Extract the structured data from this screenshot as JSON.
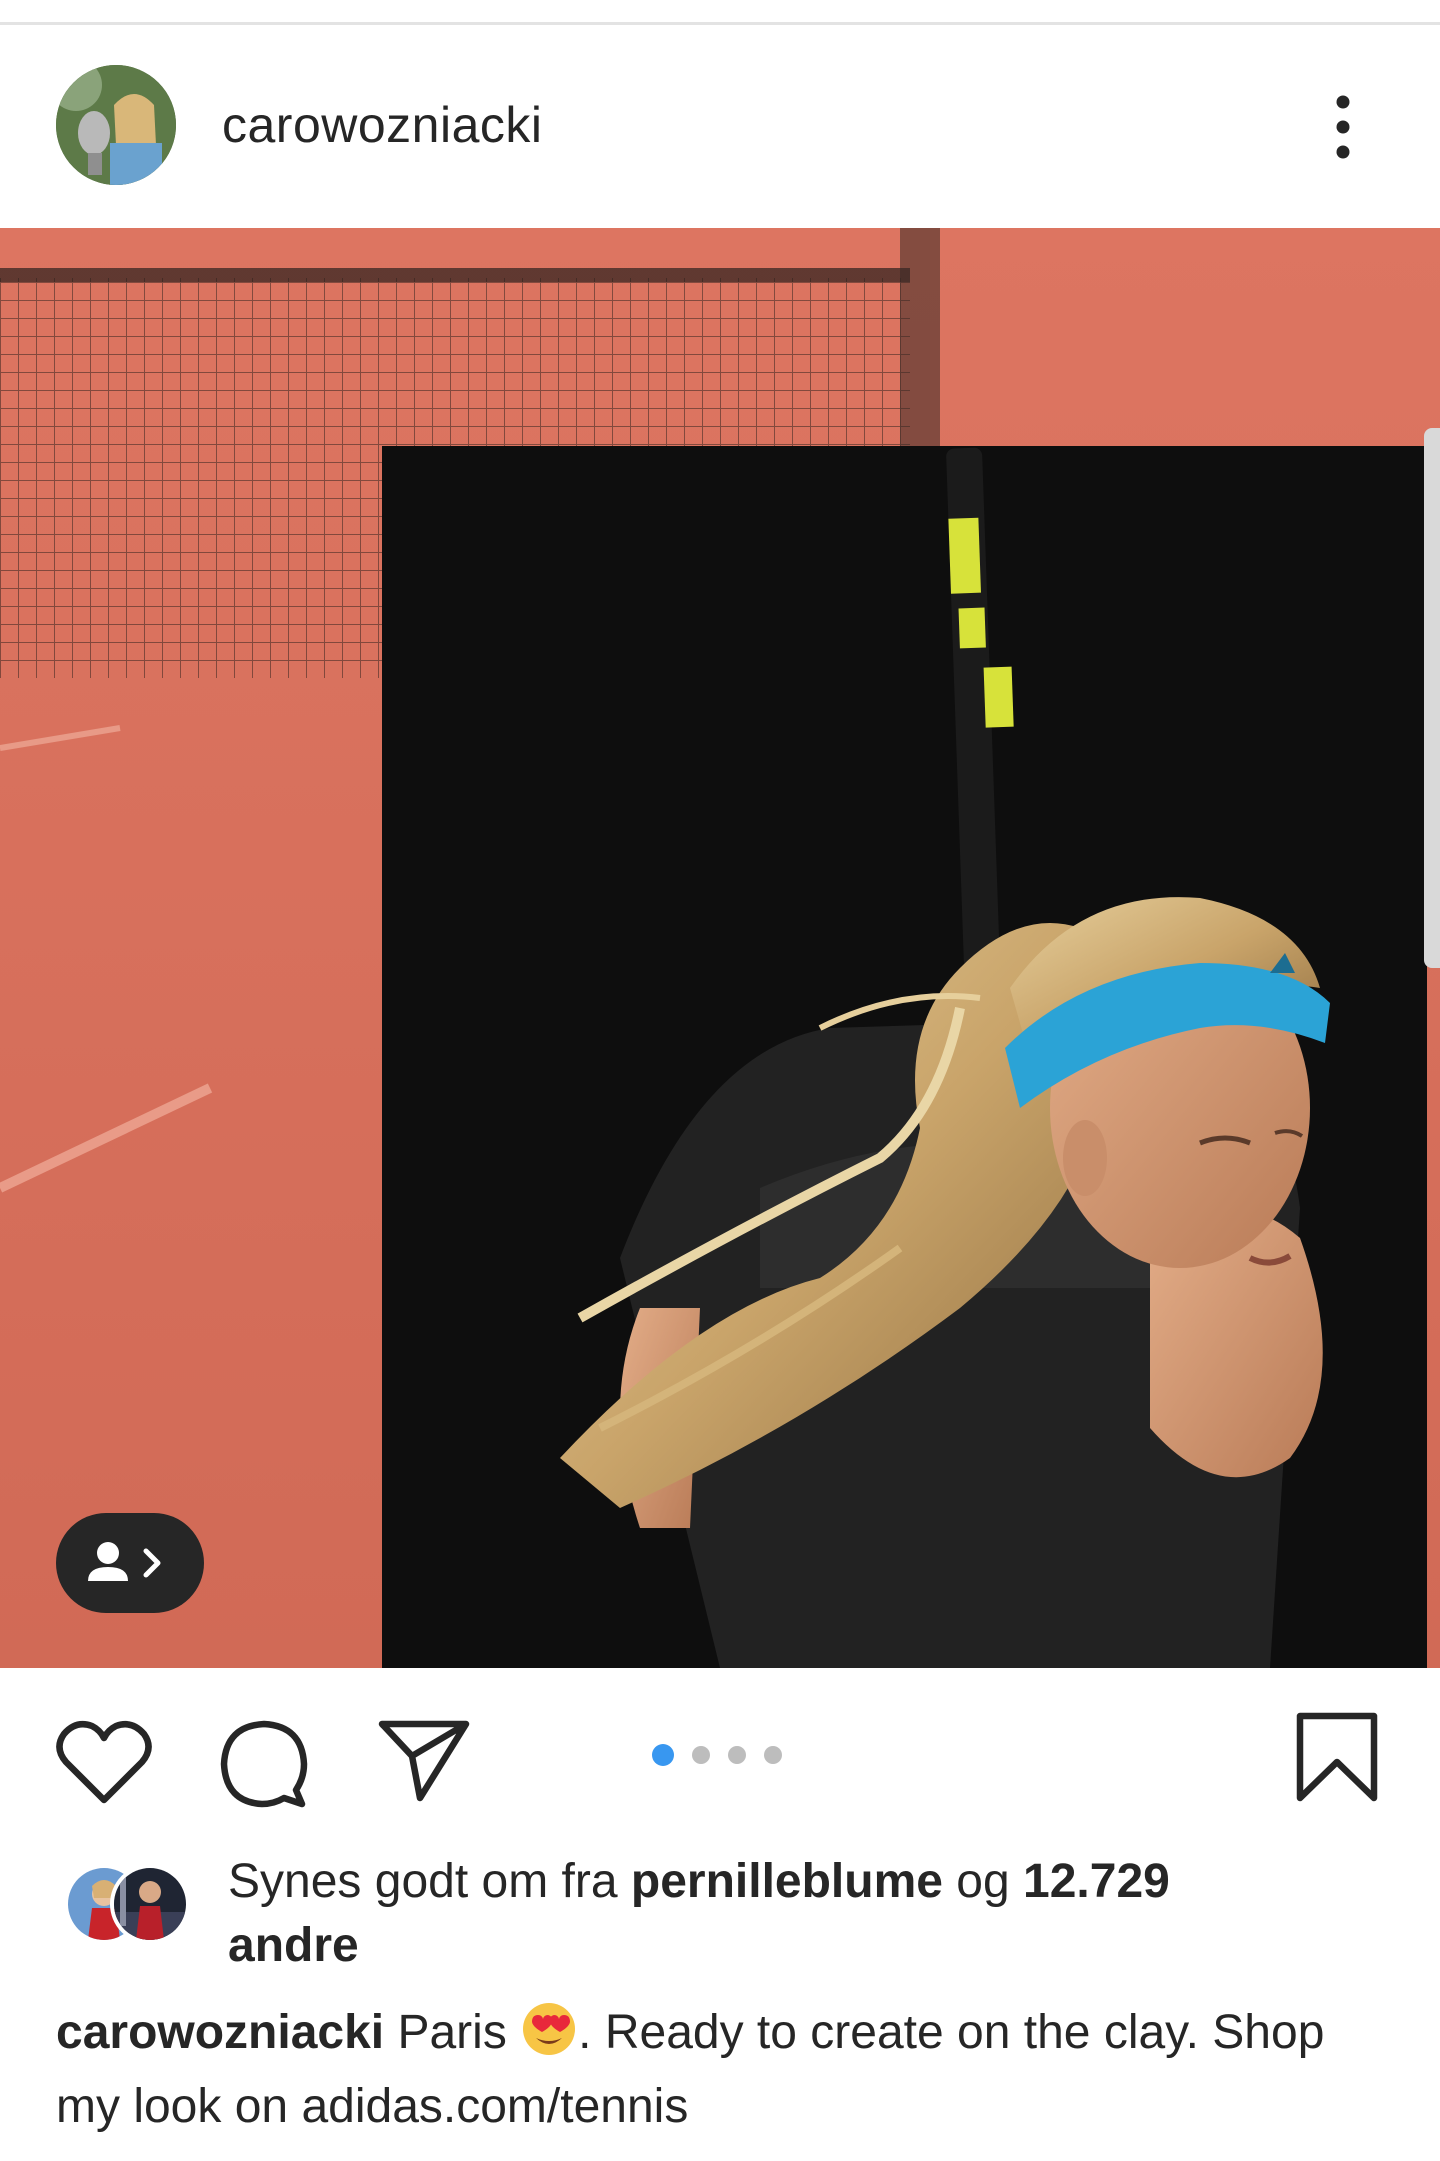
{
  "post": {
    "username": "carowozniacki",
    "slide_count": 4,
    "active_slide": 1
  },
  "likes": {
    "prefix": "Synes godt om fra ",
    "liker": "pernilleblume",
    "connector": " og ",
    "count": "12.729",
    "suffix": "andre"
  },
  "caption": {
    "username": "carowozniacki",
    "text_before_emoji": " Paris ",
    "emoji": "heart-eyes-emoji",
    "text_after_emoji": ". Ready to create on the clay. Shop my look on adidas.com/tennis"
  },
  "icons": {
    "more": "more-vertical-icon",
    "tag": "person-tag-icon",
    "like": "heart-icon",
    "comment": "comment-icon",
    "share": "send-icon",
    "save": "bookmark-icon"
  },
  "colors": {
    "accent": "#3897f0",
    "clay": "#d8705e",
    "text": "#262626"
  }
}
